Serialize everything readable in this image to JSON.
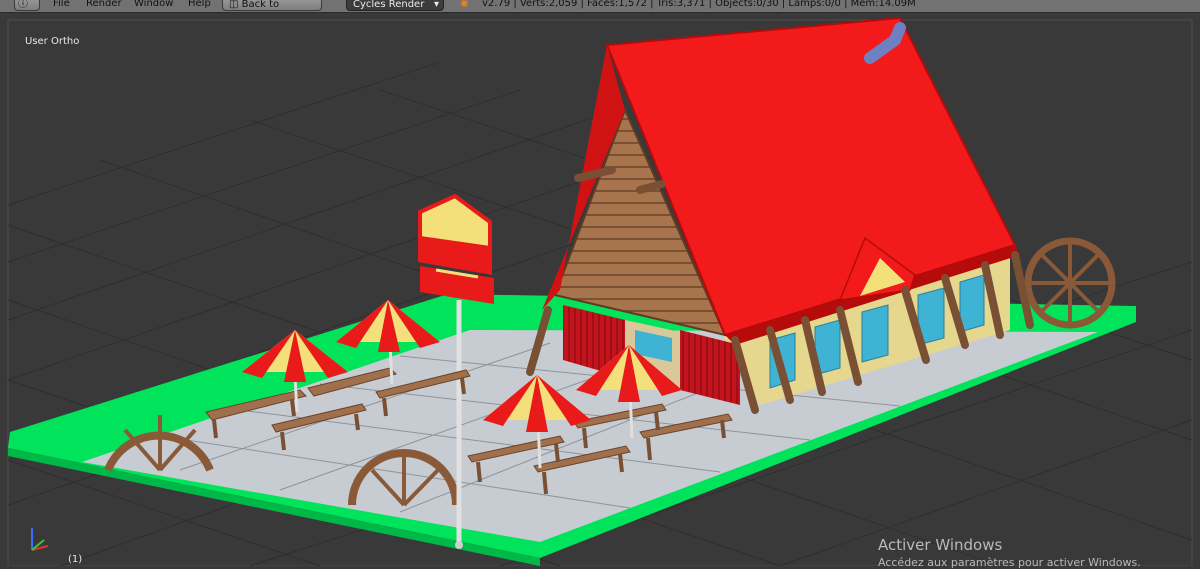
{
  "menu": {
    "file": "File",
    "render": "Render",
    "window": "Window",
    "help": "Help",
    "back_button": "Back to Previous",
    "engine": "Cycles Render",
    "stats": "v2.79 | Verts:2,059 | Faces:1,572 | Tris:3,371 | Objects:0/30 | Lamps:0/0 | Mem:14.09M"
  },
  "viewport": {
    "view_label": "User Ortho",
    "frame_label": "(1)"
  },
  "watermark": {
    "title": "Activer Windows",
    "subtitle": "Accédez aux paramètres pour activer Windows."
  },
  "icons": {
    "info": "info-icon",
    "blender": "blender-logo-icon",
    "axis": "axis-gizmo-icon"
  },
  "colors": {
    "grass": "#00e35a",
    "roof": "#f21a1a",
    "wood": "#a26f4b",
    "umbrella_red": "#e81a1a",
    "umbrella_yellow": "#f3e07a",
    "glass": "#3fb3d4"
  }
}
